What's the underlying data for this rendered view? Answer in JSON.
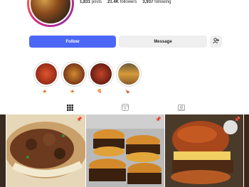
{
  "profile": {
    "stats": {
      "posts": "1,831",
      "posts_label": "posts",
      "followers": "21.4K",
      "followers_label": "followers",
      "following": "3,937",
      "following_label": "following"
    }
  },
  "actions": {
    "follow_label": "Follow",
    "message_label": "Message",
    "add_icon": "person-add-icon"
  },
  "highlights": [
    {
      "label": "🍝",
      "color": "#c0392b"
    },
    {
      "label": "🍝",
      "color": "#8e3b1f"
    },
    {
      "label": "🍕",
      "color": "#9b2d20"
    },
    {
      "label": "🍗",
      "color": "#b8860b"
    }
  ],
  "tabs": [
    {
      "icon": "grid-icon",
      "active": true
    },
    {
      "icon": "reels-icon",
      "active": false
    },
    {
      "icon": "tagged-icon",
      "active": false
    }
  ],
  "posts": [
    {
      "pinned": true
    },
    {
      "pinned": true
    },
    {
      "pinned": true
    }
  ]
}
